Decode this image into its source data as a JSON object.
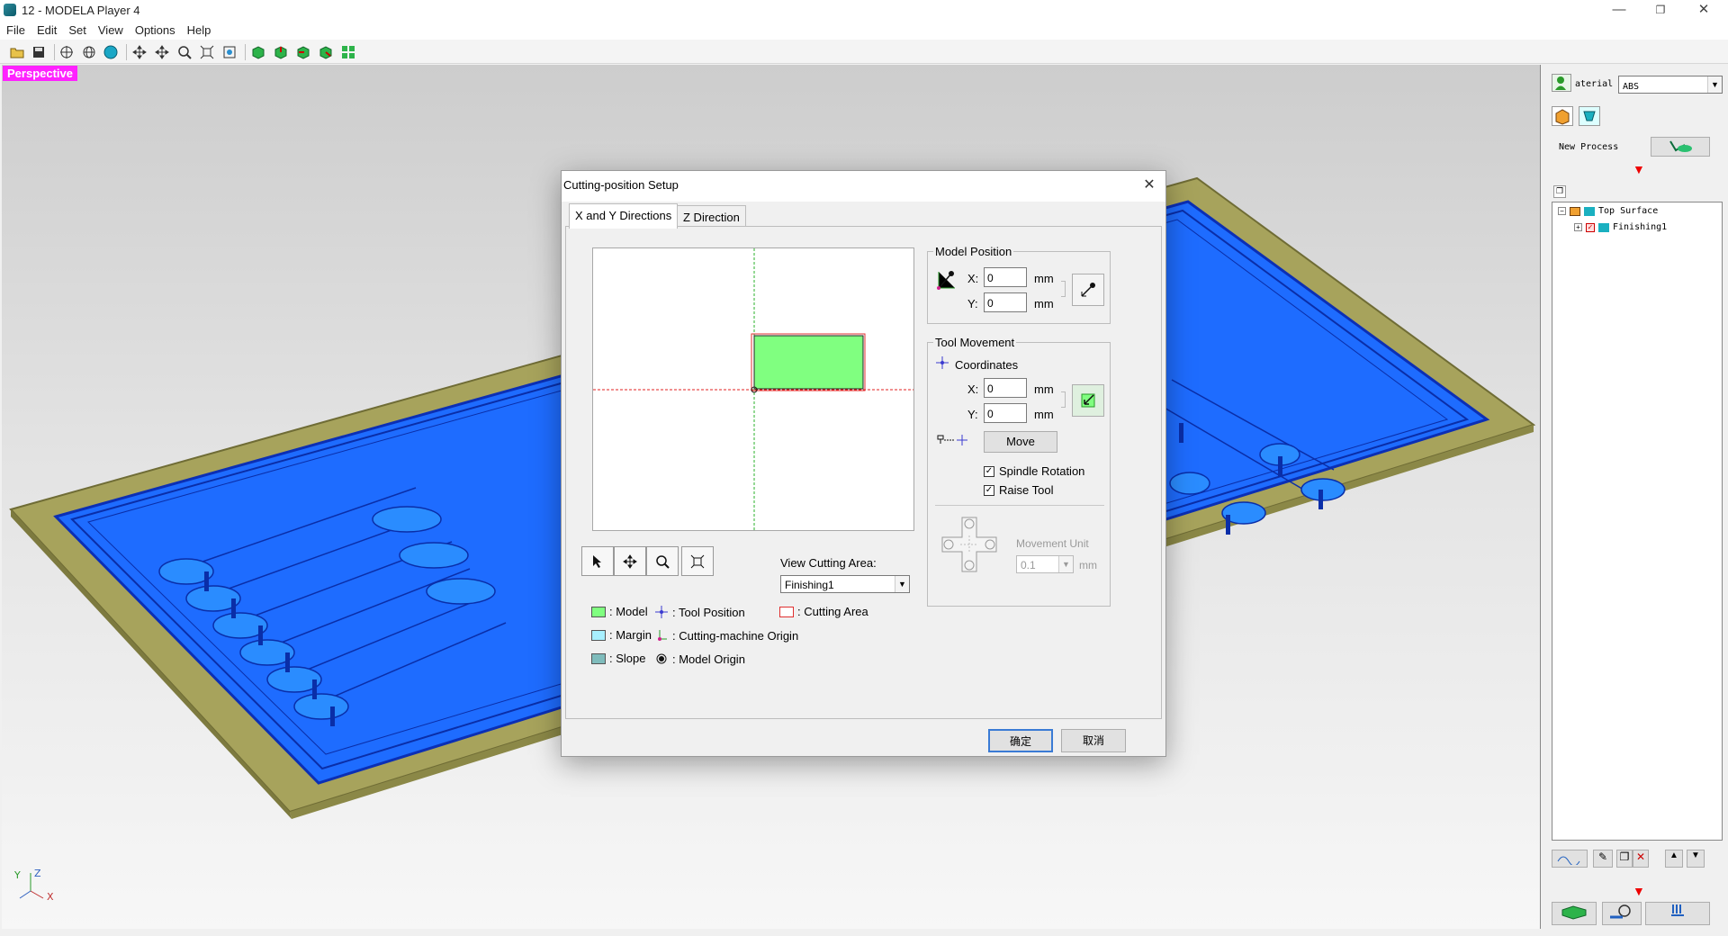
{
  "window": {
    "title": "12 - MODELA Player 4",
    "controls": [
      "—",
      "❐",
      "✕"
    ]
  },
  "menu": [
    "File",
    "Edit",
    "Set",
    "View",
    "Options",
    "Help"
  ],
  "viewport": {
    "mode_label": "Perspective",
    "axis_z": "Z",
    "axis_y": "Y",
    "axis_x": "X"
  },
  "right_panel": {
    "material_label": "aterial",
    "material_value": "ABS",
    "new_process_label": "New Process",
    "tree": [
      {
        "label": "Top Surface",
        "level": 0
      },
      {
        "label": "Finishing1",
        "level": 1
      }
    ]
  },
  "dialog": {
    "title": "Cutting-position Setup",
    "tabs": [
      "X and Y Directions",
      "Z Direction"
    ],
    "active_tab": 0,
    "view_cutting_area_label": "View Cutting Area:",
    "view_cutting_area_value": "Finishing1",
    "legend": {
      "model": ": Model",
      "margin": ": Margin",
      "slope": ": Slope",
      "tool_position": ": Tool Position",
      "machine_origin": ": Cutting-machine Origin",
      "model_origin": ": Model Origin",
      "cutting_area": ": Cutting Area"
    },
    "model_position": {
      "title": "Model Position",
      "x_label": "X:",
      "x_value": "0",
      "y_label": "Y:",
      "y_value": "0",
      "unit": "mm"
    },
    "tool_movement": {
      "title": "Tool Movement",
      "coordinates_label": "Coordinates",
      "x_label": "X:",
      "x_value": "0",
      "y_label": "Y:",
      "y_value": "0",
      "unit": "mm",
      "move_label": "Move",
      "spindle_rotation": "Spindle Rotation",
      "raise_tool": "Raise Tool",
      "movement_unit_label": "Movement Unit",
      "movement_unit_value": "0.1",
      "movement_unit_mm": "mm"
    },
    "ok_label": "确定",
    "cancel_label": "取消"
  },
  "colors": {
    "model_green": "#80ff80",
    "margin_cyan": "#a8f0ff",
    "slope_teal": "#7fbcbc",
    "board_blue": "#1e6cff",
    "base_olive": "#a7a35c",
    "perspective_badge": "#ff22ff"
  }
}
